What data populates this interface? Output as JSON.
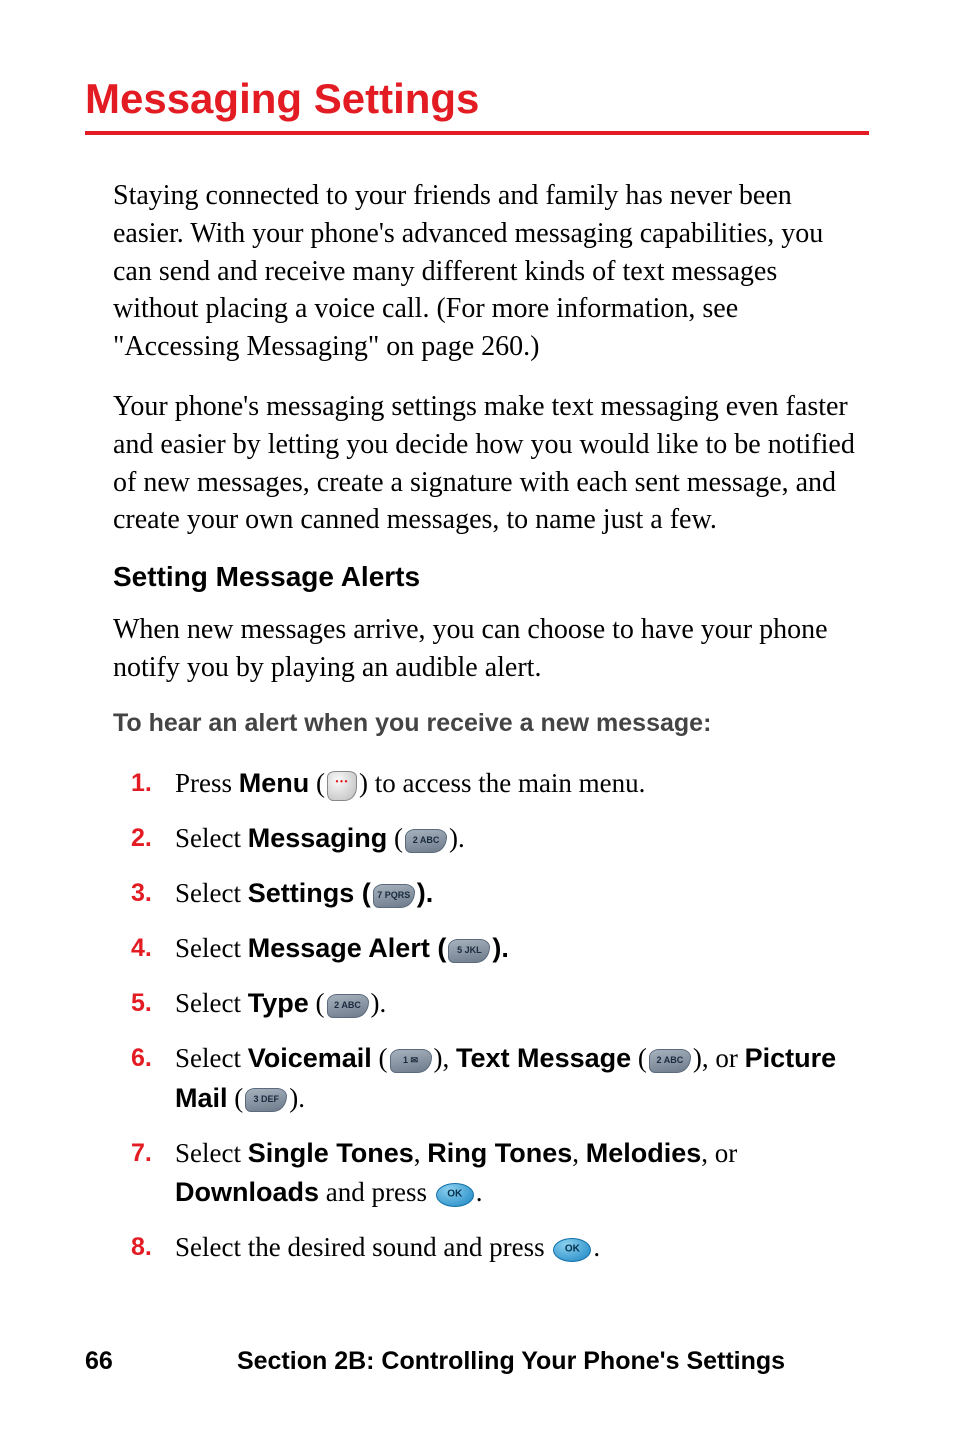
{
  "title": "Messaging Settings",
  "p1": "Staying connected to your friends and family has never been easier. With your phone's advanced messaging capabilities, you can send and receive many different kinds of text messages without placing a voice call. (For more information, see \"Accessing Messaging\" on page 260.)",
  "p2": "Your phone's messaging settings make text messaging even faster and easier by letting you decide how you would like to be notified of new messages, create a signature with each sent message, and create your own canned messages, to name just a few.",
  "subheading": "Setting Message Alerts",
  "p3": "When new messages arrive, you can choose to have your phone notify you by playing an audible alert.",
  "instr": "To hear an alert when you receive a new message:",
  "steps": {
    "s1": {
      "num": "1.",
      "pre": "Press ",
      "b1": "Menu",
      "mid": " (",
      "post": ") to access the main menu."
    },
    "s2": {
      "num": "2.",
      "pre": "Select ",
      "b1": "Messaging",
      "mid": " (",
      "post": ")."
    },
    "s3": {
      "num": "3.",
      "pre": "Select ",
      "b1": "Settings",
      "mid": " (",
      "post": ")."
    },
    "s4": {
      "num": "4.",
      "pre": "Select ",
      "b1": "Message Alert",
      "mid": " (",
      "post": ")."
    },
    "s5": {
      "num": "5.",
      "pre": "Select ",
      "b1": "Type",
      "mid": " (",
      "post": ")."
    },
    "s6": {
      "num": "6.",
      "pre": "Select ",
      "b1": "Voicemail",
      "mid1": " (",
      "mid2": "), ",
      "b2": "Text Message",
      "mid3": " (",
      "mid4": "), or ",
      "b3": "Picture Mail",
      "mid5": " (",
      "post": ")."
    },
    "s7": {
      "num": "7.",
      "pre": "Select ",
      "b1": "Single Tones",
      "sep1": ", ",
      "b2": "Ring Tones",
      "sep2": ", ",
      "b3": "Melodies",
      "sep3": ", or ",
      "b4": "Downloads",
      "post1": " and press ",
      "post2": "."
    },
    "s8": {
      "num": "8.",
      "pre": "Select the desired sound and press ",
      "post": "."
    }
  },
  "footer": {
    "page": "66",
    "section": "Section 2B: Controlling Your Phone's Settings"
  }
}
